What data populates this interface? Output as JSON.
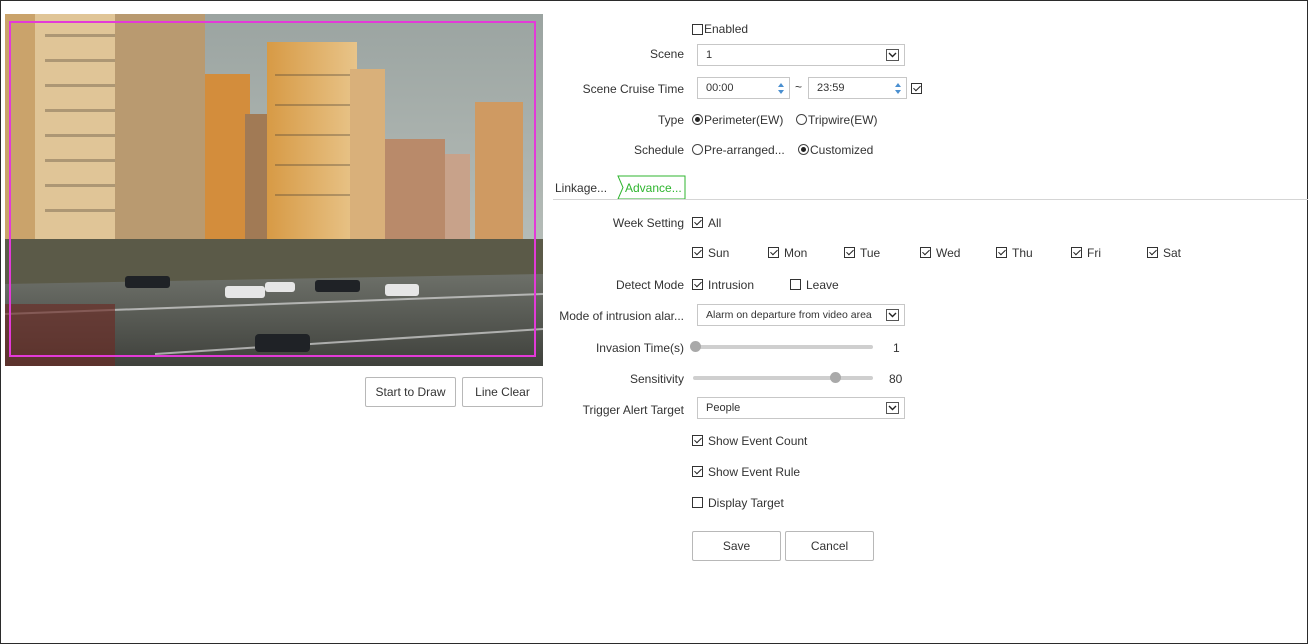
{
  "video": {
    "buttons": {
      "start_draw": "Start to Draw",
      "line_clear": "Line Clear"
    }
  },
  "form": {
    "enabled": {
      "label": "Enabled",
      "checked": false
    },
    "scene": {
      "label": "Scene",
      "value": "1"
    },
    "cruise": {
      "label": "Scene Cruise Time",
      "start": "00:00",
      "separator": "~",
      "end": "23:59",
      "checked": true
    },
    "type": {
      "label": "Type",
      "options": [
        {
          "label": "Perimeter(EW)",
          "selected": true
        },
        {
          "label": "Tripwire(EW)",
          "selected": false
        }
      ]
    },
    "schedule": {
      "label": "Schedule",
      "options": [
        {
          "label": "Pre-arranged...",
          "selected": false
        },
        {
          "label": "Customized",
          "selected": true
        }
      ]
    },
    "tabs": [
      {
        "label": "Linkage...",
        "active": false
      },
      {
        "label": "Advance...",
        "active": true
      }
    ],
    "week": {
      "label": "Week Setting",
      "all_label": "All",
      "days": [
        {
          "label": "Sun",
          "checked": true
        },
        {
          "label": "Mon",
          "checked": true
        },
        {
          "label": "Tue",
          "checked": true
        },
        {
          "label": "Wed",
          "checked": true
        },
        {
          "label": "Thu",
          "checked": true
        },
        {
          "label": "Fri",
          "checked": true
        },
        {
          "label": "Sat",
          "checked": true
        }
      ]
    },
    "detect_mode": {
      "label": "Detect Mode",
      "options": [
        {
          "label": "Intrusion",
          "checked": true
        },
        {
          "label": "Leave",
          "checked": false
        }
      ]
    },
    "intrusion_mode": {
      "label": "Mode of intrusion alar...",
      "value": "Alarm on departure from video area"
    },
    "invasion_time": {
      "label": "Invasion Time(s)",
      "value": "1",
      "fraction": 0.0
    },
    "sensitivity": {
      "label": "Sensitivity",
      "value": "80",
      "fraction": 0.8
    },
    "trigger_target": {
      "label": "Trigger Alert Target",
      "value": "People"
    },
    "show_event_count": {
      "label": "Show Event Count",
      "checked": true
    },
    "show_event_rule": {
      "label": "Show Event Rule",
      "checked": true
    },
    "display_target": {
      "label": "Display Target",
      "checked": false
    },
    "save_label": "Save",
    "cancel_label": "Cancel"
  },
  "colors": {
    "roi_border": "#e33ad8",
    "active_tab": "#2fb52f",
    "spin_arrow": "#4a8fd0"
  }
}
